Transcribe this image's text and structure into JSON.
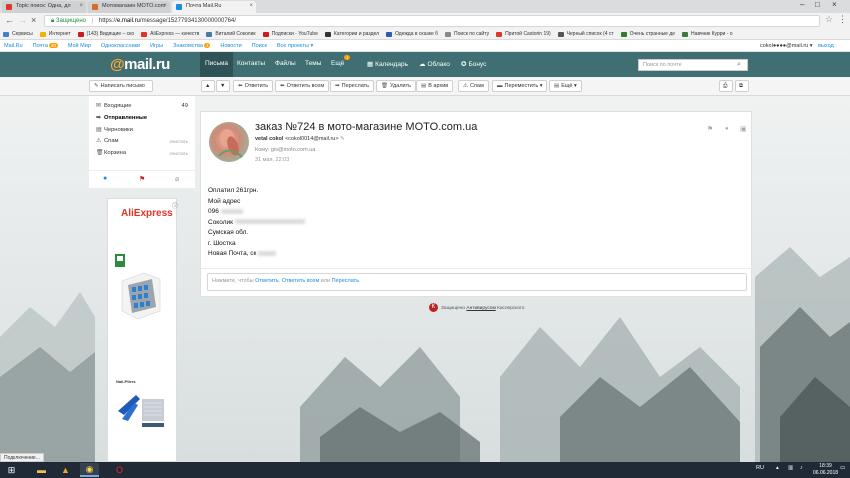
{
  "browser": {
    "tabs": [
      {
        "label": "Topic поиск: Одна, дл",
        "color": "#d93b2b"
      },
      {
        "label": "Мотомагазин MOTO.com",
        "color": "#d96b2b"
      },
      {
        "label": "Почта Mail.Ru",
        "color": "#168de2"
      }
    ],
    "address": {
      "secure_label": "Защищено",
      "url_prefix": "https://",
      "url_domain": "e.mail.ru",
      "url_path": "/message/15277934130000000764/"
    },
    "bookmarks": [
      {
        "label": "Сервисы",
        "color": "#4a7dd0"
      },
      {
        "label": "Интернет",
        "color": "#f0b400"
      },
      {
        "label": "(143) Видящие – ско",
        "color": "#cc181e"
      },
      {
        "label": "AliExpress — качеств",
        "color": "#e43225"
      },
      {
        "label": "Виталий Соколик",
        "color": "#4a76a8"
      },
      {
        "label": "Подписки - YouTube",
        "color": "#cc181e"
      },
      {
        "label": "Категории и раздел",
        "color": "#333333"
      },
      {
        "label": "Одежда в сказке б",
        "color": "#2a5db0"
      },
      {
        "label": "Поиск по сайту",
        "color": "#888888"
      },
      {
        "label": "Притой Castorin 19)",
        "color": "#d93b2b"
      },
      {
        "label": "Черный список (4 ст",
        "color": "#555555"
      },
      {
        "label": "Очень странные де",
        "color": "#2e7d32"
      },
      {
        "label": "Навчник Курри - о",
        "color": "#3e7a3e"
      }
    ]
  },
  "portal": {
    "links": [
      "Mail.Ru",
      "Почта",
      "Мой Мир",
      "Одноклассники",
      "Игры",
      "Знакомства",
      "Новости",
      "Поиск",
      "Все проекты ▾"
    ],
    "mail_badge": "48",
    "dating_badge": "3",
    "user": "cokol●●●●@mail.ru ▾",
    "logout": "выход"
  },
  "mailhead": {
    "logo_at": "@",
    "logo_text": "mail.ru",
    "nav": [
      "Письма",
      "Контакты",
      "Файлы",
      "Темы",
      "Ещё"
    ],
    "more_badge": "1",
    "calendar": "Календарь",
    "cloud": "Облако",
    "bonus": "Бонус",
    "search_placeholder": "Поиск по почте"
  },
  "toolbar": {
    "compose": "Написать письмо",
    "reply": "Ответить",
    "reply_all": "Ответить всем",
    "forward": "Переслать",
    "delete": "Удалить",
    "archive": "В архив",
    "spam": "Спам",
    "move": "Переместить ▾",
    "more": "Ещё ▾"
  },
  "folders": [
    {
      "label": "Входящие",
      "count": "49",
      "clean": ""
    },
    {
      "label": "Отправленные",
      "count": "",
      "clean": ""
    },
    {
      "label": "Черновики",
      "count": "",
      "clean": ""
    },
    {
      "label": "Спам",
      "count": "",
      "clean": "очистить"
    },
    {
      "label": "Корзина",
      "count": "",
      "clean": "очистить"
    }
  ],
  "ad": {
    "brand": "AliExpress",
    "info": "ⓘ",
    "product2": "Nail-Pliers"
  },
  "message": {
    "subject": "заказ №724 в мото-магазине MOTO.com.ua",
    "from_name": "vetal cokol",
    "from_email": "<cokol0014@mail.ru>",
    "to": "Кому: gis@moto.com.ua",
    "date": "31 мая, 22:03",
    "body": [
      "Оплатил 261грн.",
      "Мой адрес",
      "096",
      "Соколик",
      "Сумская обл.",
      "г. Шостка",
      "Новая Почта, ск"
    ],
    "reply_prefix": "Нажмите, чтобы ",
    "reply_answer": "Ответить",
    "reply_all": "Ответить всем",
    "reply_or": " или ",
    "reply_forward": "Переслать"
  },
  "kaspersky": {
    "prefix": "Защищено ",
    "link": "Антивирусом",
    "suffix": " Касперского"
  },
  "status": "Подключение...",
  "taskbar": {
    "lang": "RU",
    "time": "18:39",
    "date": "06.06.2018"
  }
}
